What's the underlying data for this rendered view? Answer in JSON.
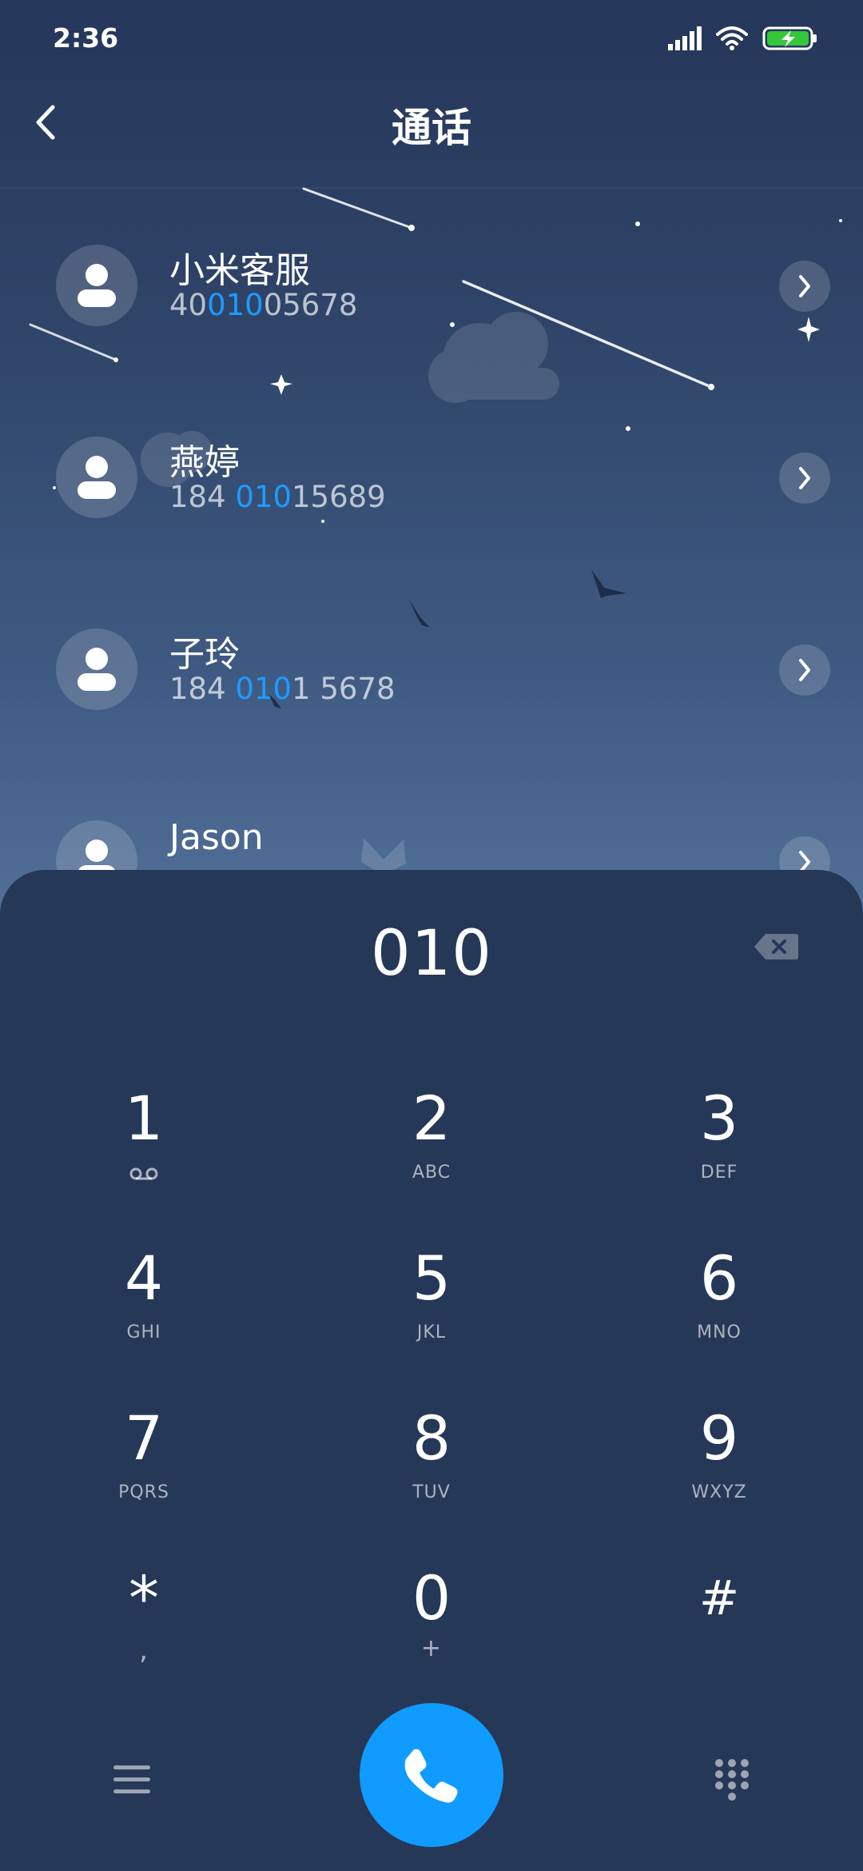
{
  "status_bar": {
    "time": "2:36",
    "icons": [
      "signal-icon",
      "wifi-icon",
      "battery-charging-icon"
    ],
    "battery_color": "#35c63a"
  },
  "header": {
    "title": "通话",
    "back_icon": "back-chevron-icon"
  },
  "contacts": [
    {
      "name": "小米客服",
      "number_parts": [
        "40",
        "010",
        "05678"
      ],
      "icon": "person-icon"
    },
    {
      "name": "燕婷",
      "number_parts": [
        "184 ",
        "010",
        "15689"
      ],
      "icon": "person-icon"
    },
    {
      "name": "子玲",
      "number_parts": [
        "184 ",
        "010",
        "1 5678"
      ],
      "icon": "person-icon"
    },
    {
      "name": "Jason",
      "number_parts": [
        "",
        "",
        ""
      ],
      "icon": "person-icon"
    }
  ],
  "dialer": {
    "input": "010",
    "keys": [
      {
        "digit": "1",
        "letters": "",
        "sub_icon": "voicemail-icon"
      },
      {
        "digit": "2",
        "letters": "ABC"
      },
      {
        "digit": "3",
        "letters": "DEF"
      },
      {
        "digit": "4",
        "letters": "GHI"
      },
      {
        "digit": "5",
        "letters": "JKL"
      },
      {
        "digit": "6",
        "letters": "MNO"
      },
      {
        "digit": "7",
        "letters": "PQRS"
      },
      {
        "digit": "8",
        "letters": "TUV"
      },
      {
        "digit": "9",
        "letters": "WXYZ"
      },
      {
        "digit": "*",
        "letters": ","
      },
      {
        "digit": "0",
        "letters": "+"
      },
      {
        "digit": "#",
        "letters": ""
      }
    ]
  },
  "colors": {
    "accent": "#0f9bff",
    "highlight": "#1e9bff",
    "panel": "#263857"
  }
}
